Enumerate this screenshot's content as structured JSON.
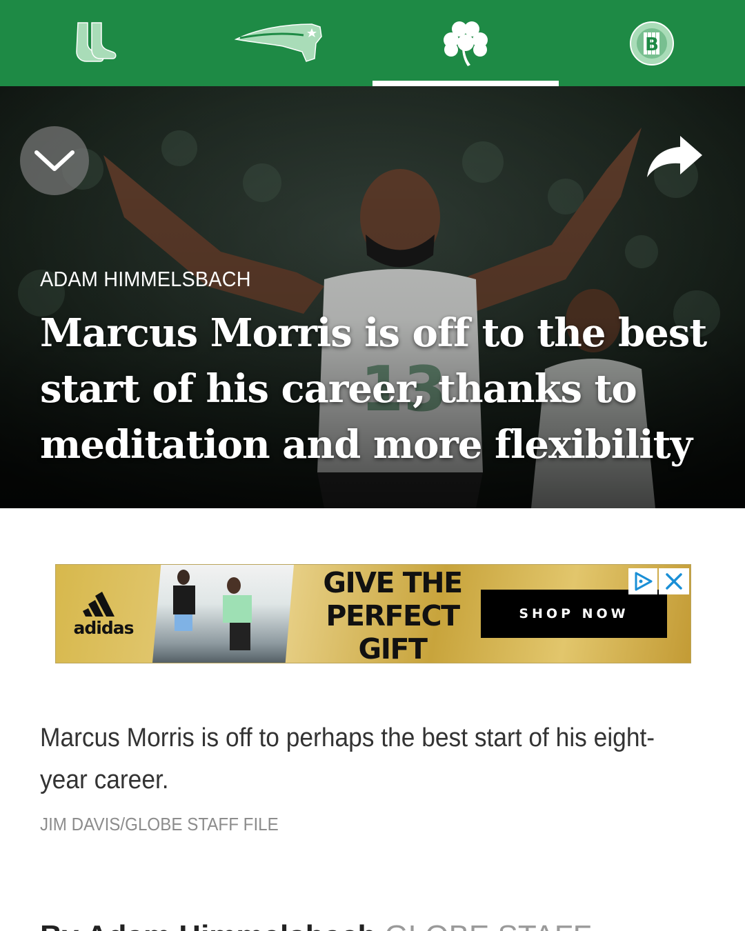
{
  "nav": {
    "tabs": [
      {
        "team": "Red Sox",
        "icon": "red-sox-socks-icon",
        "active": false
      },
      {
        "team": "Patriots",
        "icon": "patriots-logo-icon",
        "active": false
      },
      {
        "team": "Celtics",
        "icon": "shamrock-icon",
        "active": true
      },
      {
        "team": "Bruins",
        "icon": "bruins-b-logo-icon",
        "active": false
      }
    ],
    "accent_color": "#1e8a45"
  },
  "hero": {
    "author": "ADAM HIMMELSBACH",
    "headline": "Marcus Morris is off to the best start of his career, thanks to meditation and more flexibility",
    "collapse_icon": "chevron-down-icon",
    "share_icon": "share-arrow-icon"
  },
  "ad": {
    "brand": "adidas",
    "headline": "GIVE THE PERFECT GIFT",
    "cta": "SHOP NOW",
    "choices_icon": "adchoices-icon",
    "close_icon": "close-icon"
  },
  "caption": {
    "text": "Marcus Morris is off to perhaps the best start of his eight-year career.",
    "credit": "JIM DAVIS/GLOBE STAFF FILE"
  },
  "byline": {
    "name": "By Adam Himmelsbach",
    "staff": "GLOBE STAFF"
  }
}
